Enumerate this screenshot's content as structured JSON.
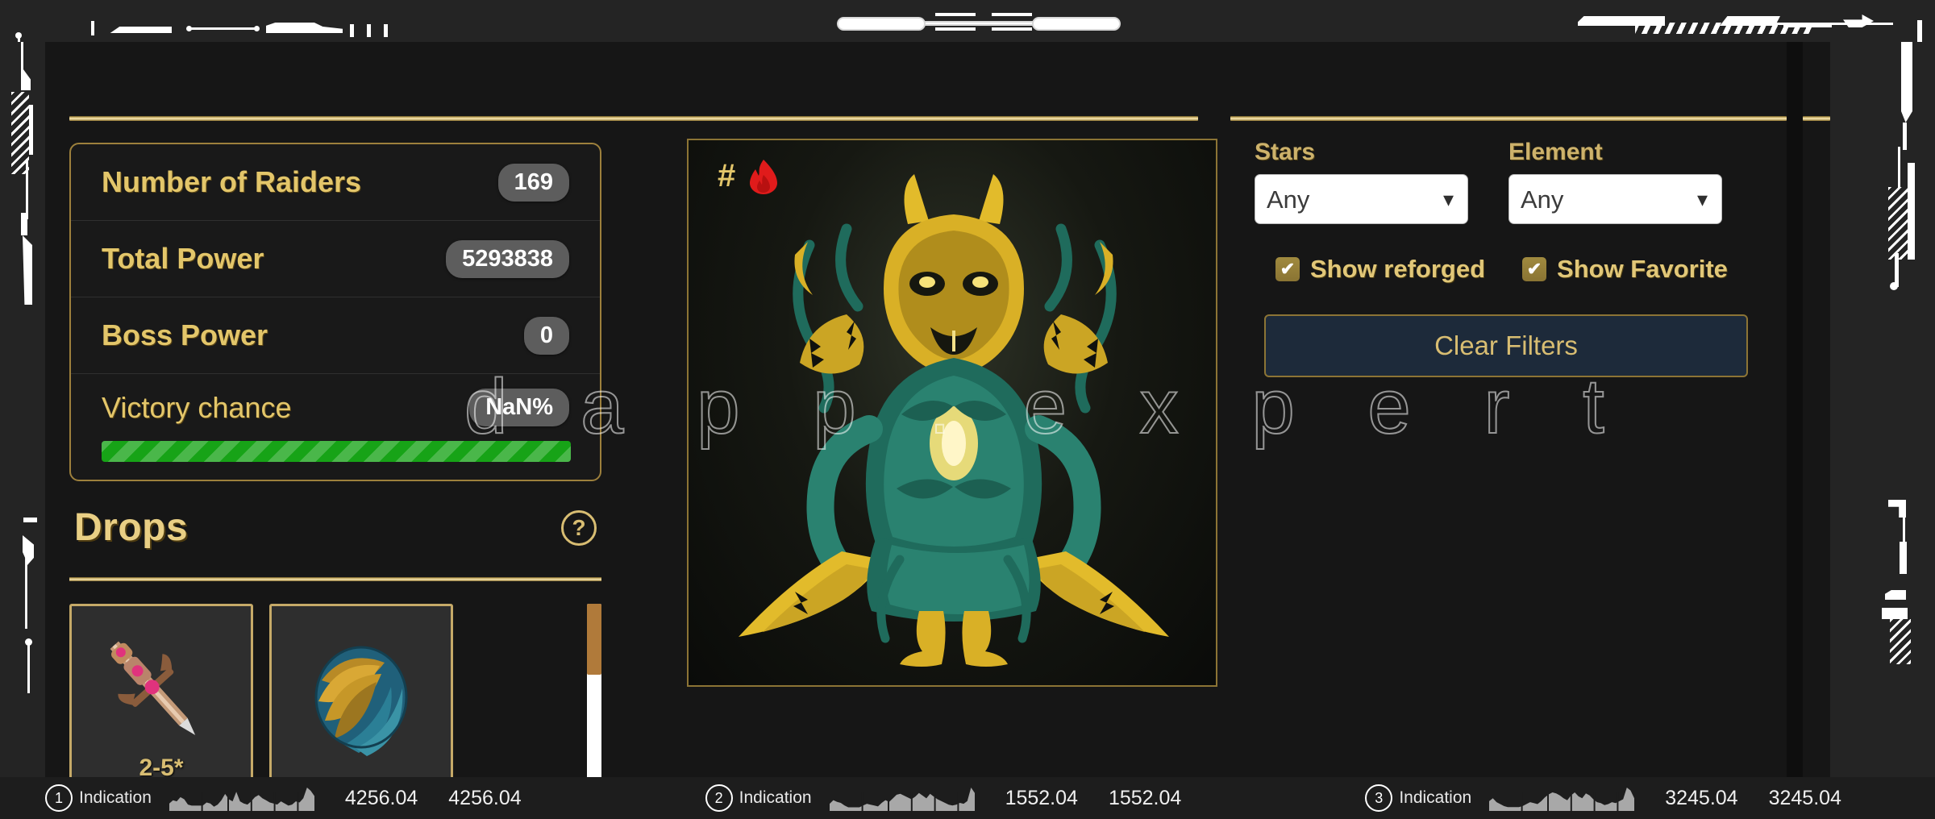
{
  "watermark": "d a p p . e x p e r t",
  "colors": {
    "gold": "#e3c66a",
    "gold_border": "#9d803c",
    "panel_bg": "#191919",
    "page_bg": "#161616",
    "badge_bg": "#5d5d5d",
    "progress_green": "#17a317",
    "flame_red": "#e01b1b",
    "button_bg": "#1d2a3a"
  },
  "stats": {
    "rows": [
      {
        "label": "Number of Raiders",
        "value": "169"
      },
      {
        "label": "Total Power",
        "value": "5293838"
      },
      {
        "label": "Boss Power",
        "value": "0"
      }
    ],
    "victory": {
      "label": "Victory chance",
      "value": "NaN%",
      "progress_percent": 100
    }
  },
  "drops": {
    "title": "Drops",
    "help_icon": "question-mark-icon",
    "items": [
      {
        "icon": "sword-item-icon",
        "quantity": "2-5*"
      },
      {
        "icon": "ring-item-icon",
        "quantity": ""
      }
    ]
  },
  "boss": {
    "hash": "#",
    "flame_icon": "fire-icon",
    "creature": "green-gold-demon-boss"
  },
  "filters": {
    "stars": {
      "label": "Stars",
      "value": "Any",
      "options": [
        "Any"
      ]
    },
    "element": {
      "label": "Element",
      "value": "Any",
      "options": [
        "Any"
      ]
    },
    "checkboxes": [
      {
        "label": "Show reforged",
        "checked": true,
        "mark": "✔"
      },
      {
        "label": "Show Favorite",
        "checked": true,
        "mark": "✔"
      }
    ],
    "clear_button": "Clear Filters"
  },
  "status_bar": {
    "items": [
      {
        "number": "1",
        "label": "Indication",
        "value1": "4256.04",
        "value2": "4256.04",
        "spark": [
          7,
          10,
          9,
          13,
          11,
          6,
          5,
          5,
          5,
          5,
          8,
          7,
          4,
          6,
          10,
          16,
          11,
          9,
          18,
          9,
          7,
          6,
          9,
          13,
          15,
          12,
          10,
          8,
          7,
          6,
          9,
          7,
          5,
          6,
          9,
          8,
          12,
          22,
          19,
          14
        ]
      },
      {
        "number": "2",
        "label": "Indication",
        "value1": "1552.04",
        "value2": "1552.04",
        "spark": [
          8,
          12,
          10,
          9,
          6,
          4,
          4,
          4,
          4,
          6,
          8,
          7,
          6,
          5,
          9,
          12,
          10,
          14,
          18,
          19,
          17,
          15,
          13,
          16,
          20,
          17,
          14,
          19,
          16,
          13,
          11,
          9,
          7,
          6,
          7,
          9,
          8,
          11,
          26,
          20
        ]
      },
      {
        "number": "3",
        "label": "Indication",
        "value1": "3245.04",
        "value2": "3245.04",
        "spark": [
          10,
          13,
          9,
          7,
          5,
          4,
          4,
          4,
          4,
          5,
          7,
          9,
          8,
          7,
          10,
          14,
          17,
          19,
          18,
          16,
          13,
          11,
          16,
          19,
          15,
          13,
          18,
          16,
          12,
          9,
          8,
          6,
          7,
          9,
          8,
          10,
          12,
          24,
          21,
          13
        ]
      }
    ]
  }
}
